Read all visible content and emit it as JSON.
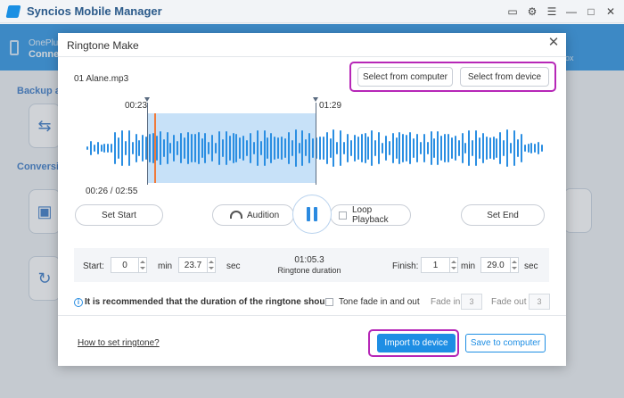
{
  "app": {
    "title": "Syncios Mobile Manager",
    "device_name": "OnePlus",
    "device_status": "Connect",
    "toolbox_label": "ox",
    "sections": [
      "Backup an",
      "Conversion"
    ]
  },
  "dialog": {
    "title": "Ringtone Make",
    "close_icon": "close-icon",
    "file_name": "01 Alane.mp3",
    "select_from_computer": "Select from computer",
    "select_from_device": "Select from device",
    "marker_start_label": "00:23",
    "marker_end_label": "01:29",
    "playback_time": "00:26 / 02:55",
    "set_start": "Set Start",
    "audition": "Audition",
    "loop_playback": "Loop Playback",
    "set_end": "Set End",
    "start_label": "Start:",
    "start_min": "0",
    "min_unit": "min",
    "start_sec": "23.7",
    "sec_unit": "sec",
    "duration_value": "01:05.3",
    "duration_label": "Ringtone duration",
    "finish_label": "Finish:",
    "finish_min": "1",
    "finish_sec": "29.0",
    "tip": "It is recommended that the duration of the ringtone shou...",
    "tone_fade": "Tone fade in and out",
    "fade_in_label": "Fade in",
    "fade_in_value": "3",
    "fade_out_label": "Fade out",
    "fade_out_value": "3",
    "howto_link": "How to set ringtone?",
    "import_to_device": "Import to device",
    "save_to_computer": "Save to computer"
  },
  "colors": {
    "accent": "#1e8ee4",
    "highlight": "#b627b7",
    "playhead": "#f07a3a",
    "selection": "#c7e1f8"
  },
  "waveform": {
    "selection_start_fraction": 0.135,
    "selection_end_fraction": 0.509,
    "playhead_fraction": 0.149
  }
}
